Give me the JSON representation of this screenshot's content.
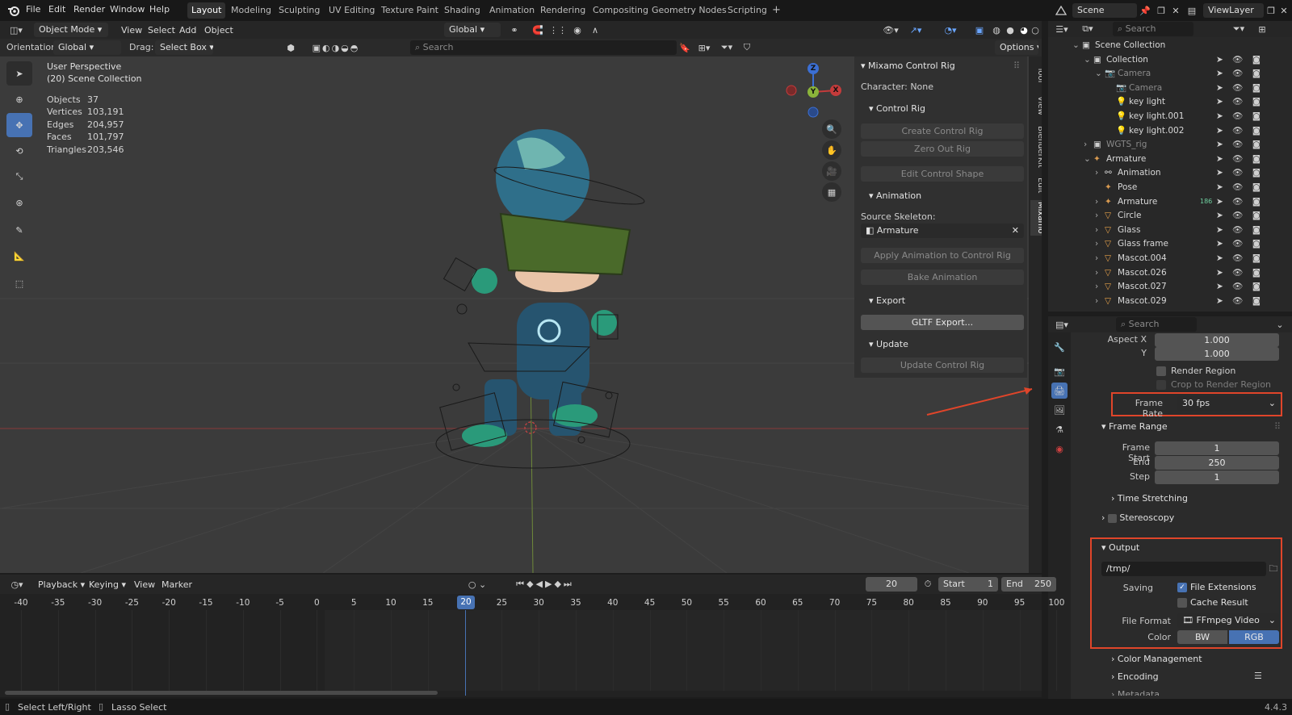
{
  "topbar": {
    "menus": [
      "File",
      "Edit",
      "Render",
      "Window",
      "Help"
    ],
    "workspaces": [
      "Layout",
      "Modeling",
      "Sculpting",
      "UV Editing",
      "Texture Paint",
      "Shading",
      "Animation",
      "Rendering",
      "Compositing",
      "Geometry Nodes",
      "Scripting"
    ],
    "active_workspace": "Layout",
    "add_tab": "+",
    "scene_name": "Scene",
    "view_layer": "ViewLayer"
  },
  "viewport_header": {
    "mode": "Object Mode",
    "menus": [
      "View",
      "Select",
      "Add",
      "Object"
    ],
    "transform_orientation": "Global",
    "orientation_label": "Orientation:",
    "orientation_value": "Global",
    "drag_label": "Drag:",
    "drag_value": "Select Box",
    "search_placeholder": "Search",
    "options_label": "Options"
  },
  "overlay_stats": {
    "view_name": "User Perspective",
    "collection": "(20) Scene Collection",
    "rows": [
      {
        "label": "Objects",
        "value": "37"
      },
      {
        "label": "Vertices",
        "value": "103,191"
      },
      {
        "label": "Edges",
        "value": "204,957"
      },
      {
        "label": "Faces",
        "value": "101,797"
      },
      {
        "label": "Triangles",
        "value": "203,546"
      }
    ]
  },
  "gizmo": {
    "z": "Z",
    "y": "Y",
    "x": "X"
  },
  "npanel": {
    "title": "Mixamo Control Rig",
    "character": "Character: None",
    "control_rig_header": "Control Rig",
    "create_control_rig": "Create Control Rig",
    "zero_out_rig": "Zero Out Rig",
    "edit_control_shape": "Edit Control Shape",
    "animation_header": "Animation",
    "source_skeleton_label": "Source Skeleton:",
    "source_skeleton_value": "Armature",
    "apply_animation": "Apply Animation to Control Rig",
    "bake_animation": "Bake Animation",
    "export_header": "Export",
    "gltf_export": "GLTF Export...",
    "update_header": "Update",
    "update_control_rig": "Update Control Rig",
    "tabs": [
      "Tool",
      "View",
      "BlenderKit",
      "Edit",
      "Mixamo"
    ]
  },
  "outliner": {
    "search_placeholder": "Search",
    "rows": [
      {
        "label": "Scene Collection",
        "indent": 0
      },
      {
        "label": "Collection",
        "indent": 1
      },
      {
        "label": "Camera",
        "indent": 2
      },
      {
        "label": "Camera",
        "indent": 3
      },
      {
        "label": "key light",
        "indent": 3
      },
      {
        "label": "key light.001",
        "indent": 3
      },
      {
        "label": "key light.002",
        "indent": 3
      },
      {
        "label": "WGTS_rig",
        "indent": 1
      },
      {
        "label": "Armature",
        "indent": 1
      },
      {
        "label": "Animation",
        "indent": 2
      },
      {
        "label": "Pose",
        "indent": 2
      },
      {
        "label": "Armature",
        "indent": 2
      },
      {
        "label": "Circle",
        "indent": 2
      },
      {
        "label": "Glass",
        "indent": 2
      },
      {
        "label": "Glass frame",
        "indent": 2
      },
      {
        "label": "Mascot.004",
        "indent": 2
      },
      {
        "label": "Mascot.026",
        "indent": 2
      },
      {
        "label": "Mascot.027",
        "indent": 2
      },
      {
        "label": "Mascot.029",
        "indent": 2
      }
    ],
    "armature_bone_count": "186"
  },
  "properties": {
    "search_placeholder": "Search",
    "aspect_x_label": "Aspect X",
    "aspect_x_value": "1.000",
    "aspect_y_label": "Y",
    "aspect_y_value": "1.000",
    "render_region": "Render Region",
    "crop_to_render_region": "Crop to Render Region",
    "frame_rate_label": "Frame Rate",
    "frame_rate_value": "30 fps",
    "frame_range_header": "Frame Range",
    "frame_start_label": "Frame Start",
    "frame_start_value": "1",
    "end_label": "End",
    "end_value": "250",
    "step_label": "Step",
    "step_value": "1",
    "time_stretching": "Time Stretching",
    "stereoscopy": "Stereoscopy",
    "output_header": "Output",
    "output_path": "/tmp/",
    "saving_label": "Saving",
    "file_extensions": "File Extensions",
    "cache_result": "Cache Result",
    "file_format_label": "File Format",
    "file_format_value": "FFmpeg Video",
    "color_label": "Color",
    "color_bw": "BW",
    "color_rgb": "RGB",
    "color_management": "Color Management",
    "encoding": "Encoding",
    "metadata": "Metadata"
  },
  "timeline": {
    "menus": [
      "Playback",
      "Keying",
      "View",
      "Marker"
    ],
    "current_frame": "20",
    "start_label": "Start",
    "start_value": "1",
    "end_label": "End",
    "end_value": "250",
    "ticks": [
      "-40",
      "-35",
      "-30",
      "-25",
      "-20",
      "-15",
      "-10",
      "-5",
      "0",
      "5",
      "10",
      "15",
      "20",
      "25",
      "30",
      "35",
      "40",
      "45",
      "50",
      "55",
      "60",
      "65",
      "70",
      "75",
      "80",
      "85",
      "90",
      "95",
      "100"
    ]
  },
  "statusbar": {
    "select": "Select Left/Right",
    "lasso": "Lasso Select",
    "version": "4.4.3"
  },
  "colors": {
    "accent": "#4772b3",
    "highlight_box": "#e0452a",
    "viewport_bg": "#3b3b3b",
    "x_axis": "#c43b3b",
    "y_axis": "#8bb43a",
    "z_axis": "#3b6fd4"
  }
}
